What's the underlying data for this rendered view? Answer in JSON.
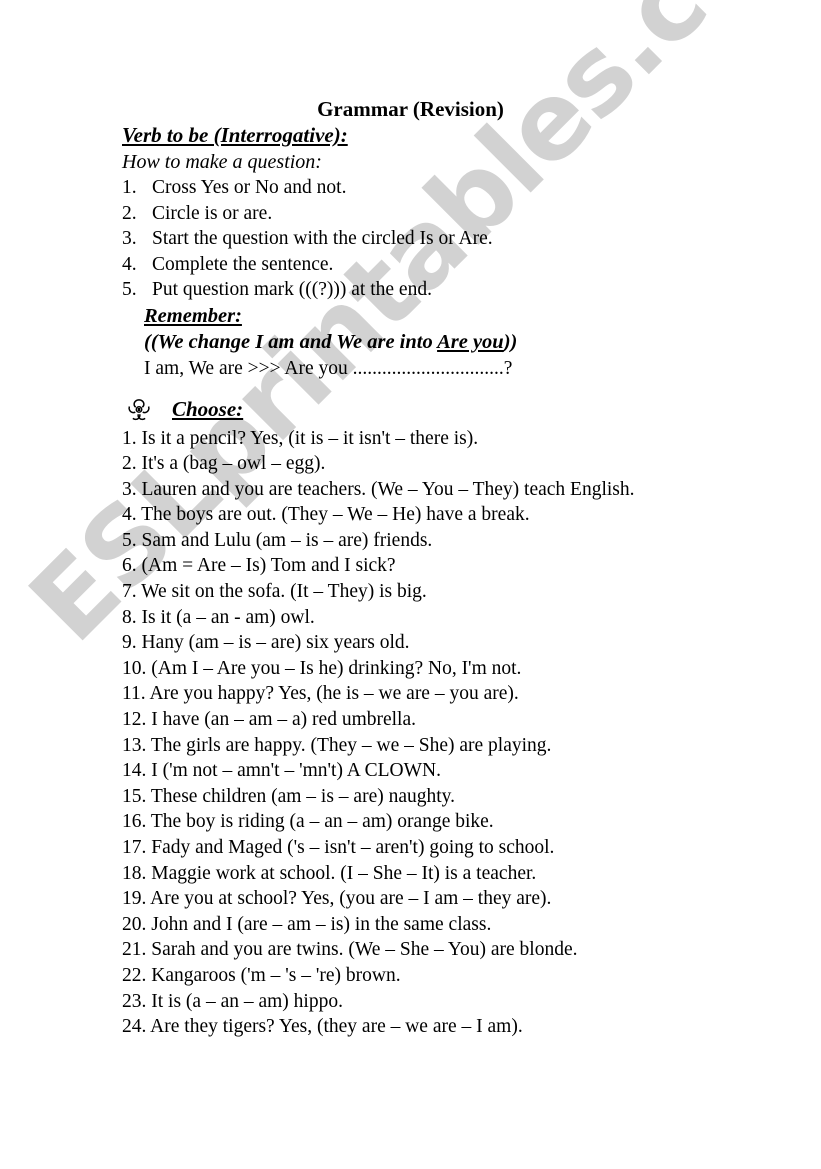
{
  "document": {
    "title": "Grammar (Revision)",
    "section_heading": "Verb to be (Interrogative):",
    "howto_label": "How to make a question:",
    "steps": [
      {
        "num": "1.",
        "text": "Cross Yes or No and not."
      },
      {
        "num": "2.",
        "text": "Circle is or are."
      },
      {
        "num": "3.",
        "text": "Start the question with the circled Is or Are."
      },
      {
        "num": "4.",
        "text": "Complete the sentence."
      },
      {
        "num": "5.",
        "text": "Put question mark (((?))) at the end."
      }
    ],
    "remember_label": "Remember:",
    "rule": {
      "before": "((We change I am and We are into ",
      "underlined": "Are you",
      "after": "))"
    },
    "example": "I am, We are >>> Are you ...............................?",
    "choose_label": "Choose:",
    "choose_icon": "flower-icon",
    "questions": [
      "1. Is it a pencil? Yes, (it is – it isn't – there is).",
      "2. It's a (bag – owl – egg).",
      "3. Lauren and you are teachers. (We – You – They) teach English.",
      "4. The boys are out. (They – We – He) have a break.",
      "5. Sam and Lulu (am – is – are) friends.",
      "6. (Am = Are – Is) Tom and I sick?",
      "7. We sit on the sofa. (It – They) is big.",
      "8. Is it (a – an - am) owl.",
      "9. Hany (am – is – are) six years old.",
      "10. (Am I – Are you – Is he) drinking? No, I'm not.",
      "11. Are you happy? Yes, (he is – we are – you are).",
      "12. I have (an – am – a) red umbrella.",
      "13. The girls are happy. (They – we – She) are playing.",
      "14. I ('m not – amn't – 'mn't) A CLOWN.",
      "15. These children (am – is – are) naughty.",
      "16. The boy is riding (a – an – am) orange bike.",
      "17. Fady and Maged ('s – isn't – aren't) going to school.",
      "18. Maggie work at school. (I – She – It) is a teacher.",
      "19. Are you at school? Yes, (you are – I am – they are).",
      "20. John and I (are – am – is) in the same class.",
      "21. Sarah and you are twins. (We – She – You) are blonde.",
      "22. Kangaroos ('m – 's – 're) brown.",
      "23. It is (a – an – am) hippo.",
      "24. Are they tigers? Yes, (they are – we are – I am)."
    ]
  },
  "watermark": {
    "text": "ESLprintables.com",
    "color": "#d2d2d2"
  }
}
